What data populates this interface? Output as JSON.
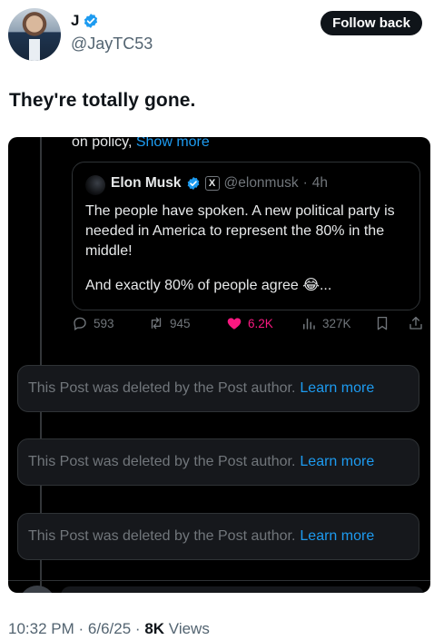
{
  "author": {
    "display_name": "J",
    "handle": "@JayTC53",
    "follow_label": "Follow back"
  },
  "tweet": {
    "text": "They're totally gone."
  },
  "embedded": {
    "truncated_text": "on policy,",
    "show_more": "Show more",
    "quote": {
      "name": "Elon Musk",
      "badge": "X",
      "handle": "@elonmusk",
      "separator": "·",
      "time": "4h",
      "para1": "The people have spoken. A new political party is needed in America to represent the 80% in the middle!",
      "para2": "And exactly 80% of people agree 😂..."
    },
    "actions": {
      "replies": "593",
      "reposts": "945",
      "likes": "6.2K",
      "views": "327K"
    },
    "deleted_posts": [
      {
        "text": "This Post was deleted by the Post author.",
        "link": "Learn more"
      },
      {
        "text": "This Post was deleted by the Post author.",
        "link": "Learn more"
      },
      {
        "text": "This Post was deleted by the Post author.",
        "link": "Learn more"
      }
    ]
  },
  "meta": {
    "time": "10:32 PM",
    "sep1": "·",
    "date": "6/6/25",
    "sep2": "·",
    "views_count": "8K",
    "views_label": "Views"
  },
  "colors": {
    "accent": "#1d9bf0",
    "like": "#f91880",
    "muted": "#71767b"
  },
  "icons": [
    "verified-badge-icon",
    "reply-icon",
    "repost-icon",
    "heart-icon",
    "views-chart-icon",
    "bookmark-icon",
    "share-icon"
  ]
}
